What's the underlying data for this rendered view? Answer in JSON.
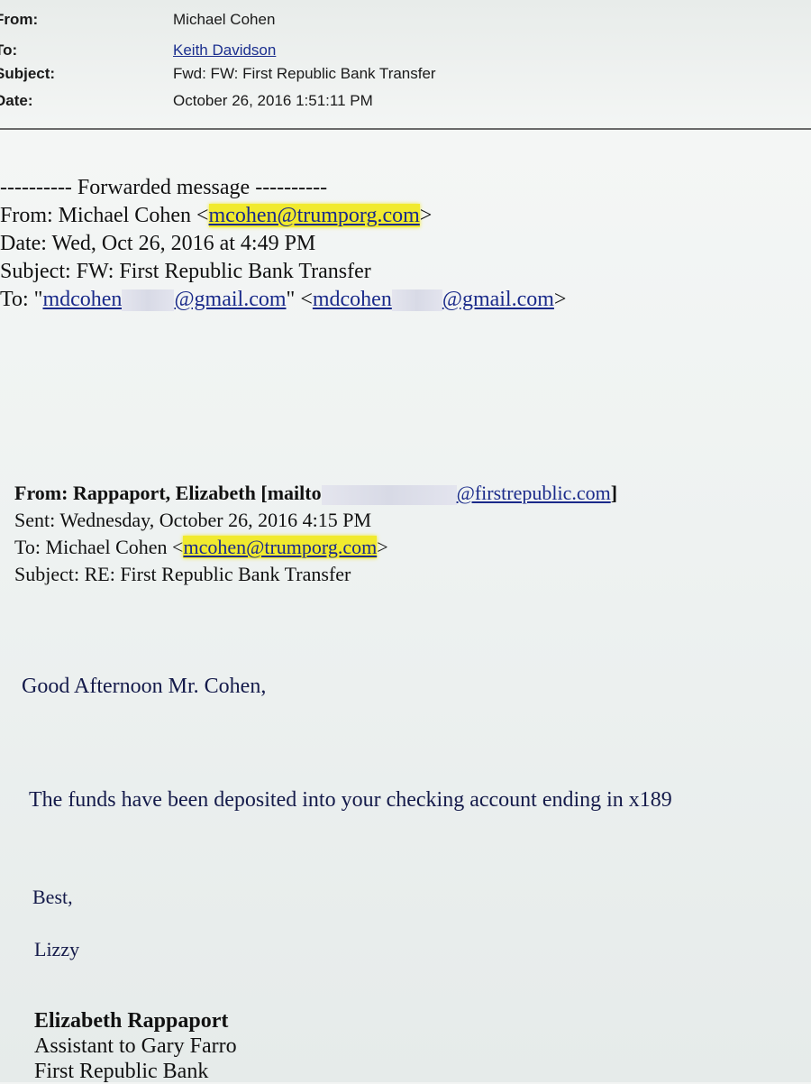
{
  "header": {
    "from_label": "From:",
    "from_value": "Michael Cohen",
    "to_label": "To:",
    "to_value": "Keith Davidson",
    "subject_label": "Subject:",
    "subject_value": "Fwd: FW: First Republic Bank Transfer",
    "date_label": "Date:",
    "date_value": "October 26, 2016 1:51:11 PM"
  },
  "forwarded": {
    "divider": "---------- Forwarded message ----------",
    "from_prefix": "From: Michael Cohen <",
    "from_email": "mcohen@trumporg.com",
    "from_suffix": ">",
    "date": "Date: Wed, Oct 26, 2016 at 4:49 PM",
    "subject": "Subject: FW: First Republic Bank Transfer",
    "to_prefix": "To: \"",
    "to_email1_start": "mdcohen",
    "to_email1_end": "@gmail.com",
    "to_mid": "\" <",
    "to_email2_start": "mdcohen",
    "to_email2_end": "@gmail.com",
    "to_suffix": ">"
  },
  "original": {
    "from_prefix": "From: Rappaport, Elizabeth [mailto",
    "from_email_end": "@firstrepublic.com",
    "from_suffix": "]",
    "sent": "Sent: Wednesday, October 26, 2016 4:15 PM",
    "to_prefix": "To: Michael Cohen <",
    "to_email": "mcohen@trumporg.com",
    "to_suffix": ">",
    "subject": "Subject: RE: First Republic Bank Transfer"
  },
  "body": {
    "greeting": "Good Afternoon Mr. Cohen,",
    "message": "The funds have been deposited into your checking account ending in x189",
    "closing": "Best,",
    "name": "Lizzy"
  },
  "signature": {
    "name": "Elizabeth Rappaport",
    "title": "Assistant to Gary Farro",
    "company": "First Republic Bank"
  },
  "colors": {
    "highlight": "#f1ea2e",
    "link": "#1a2a8a"
  }
}
